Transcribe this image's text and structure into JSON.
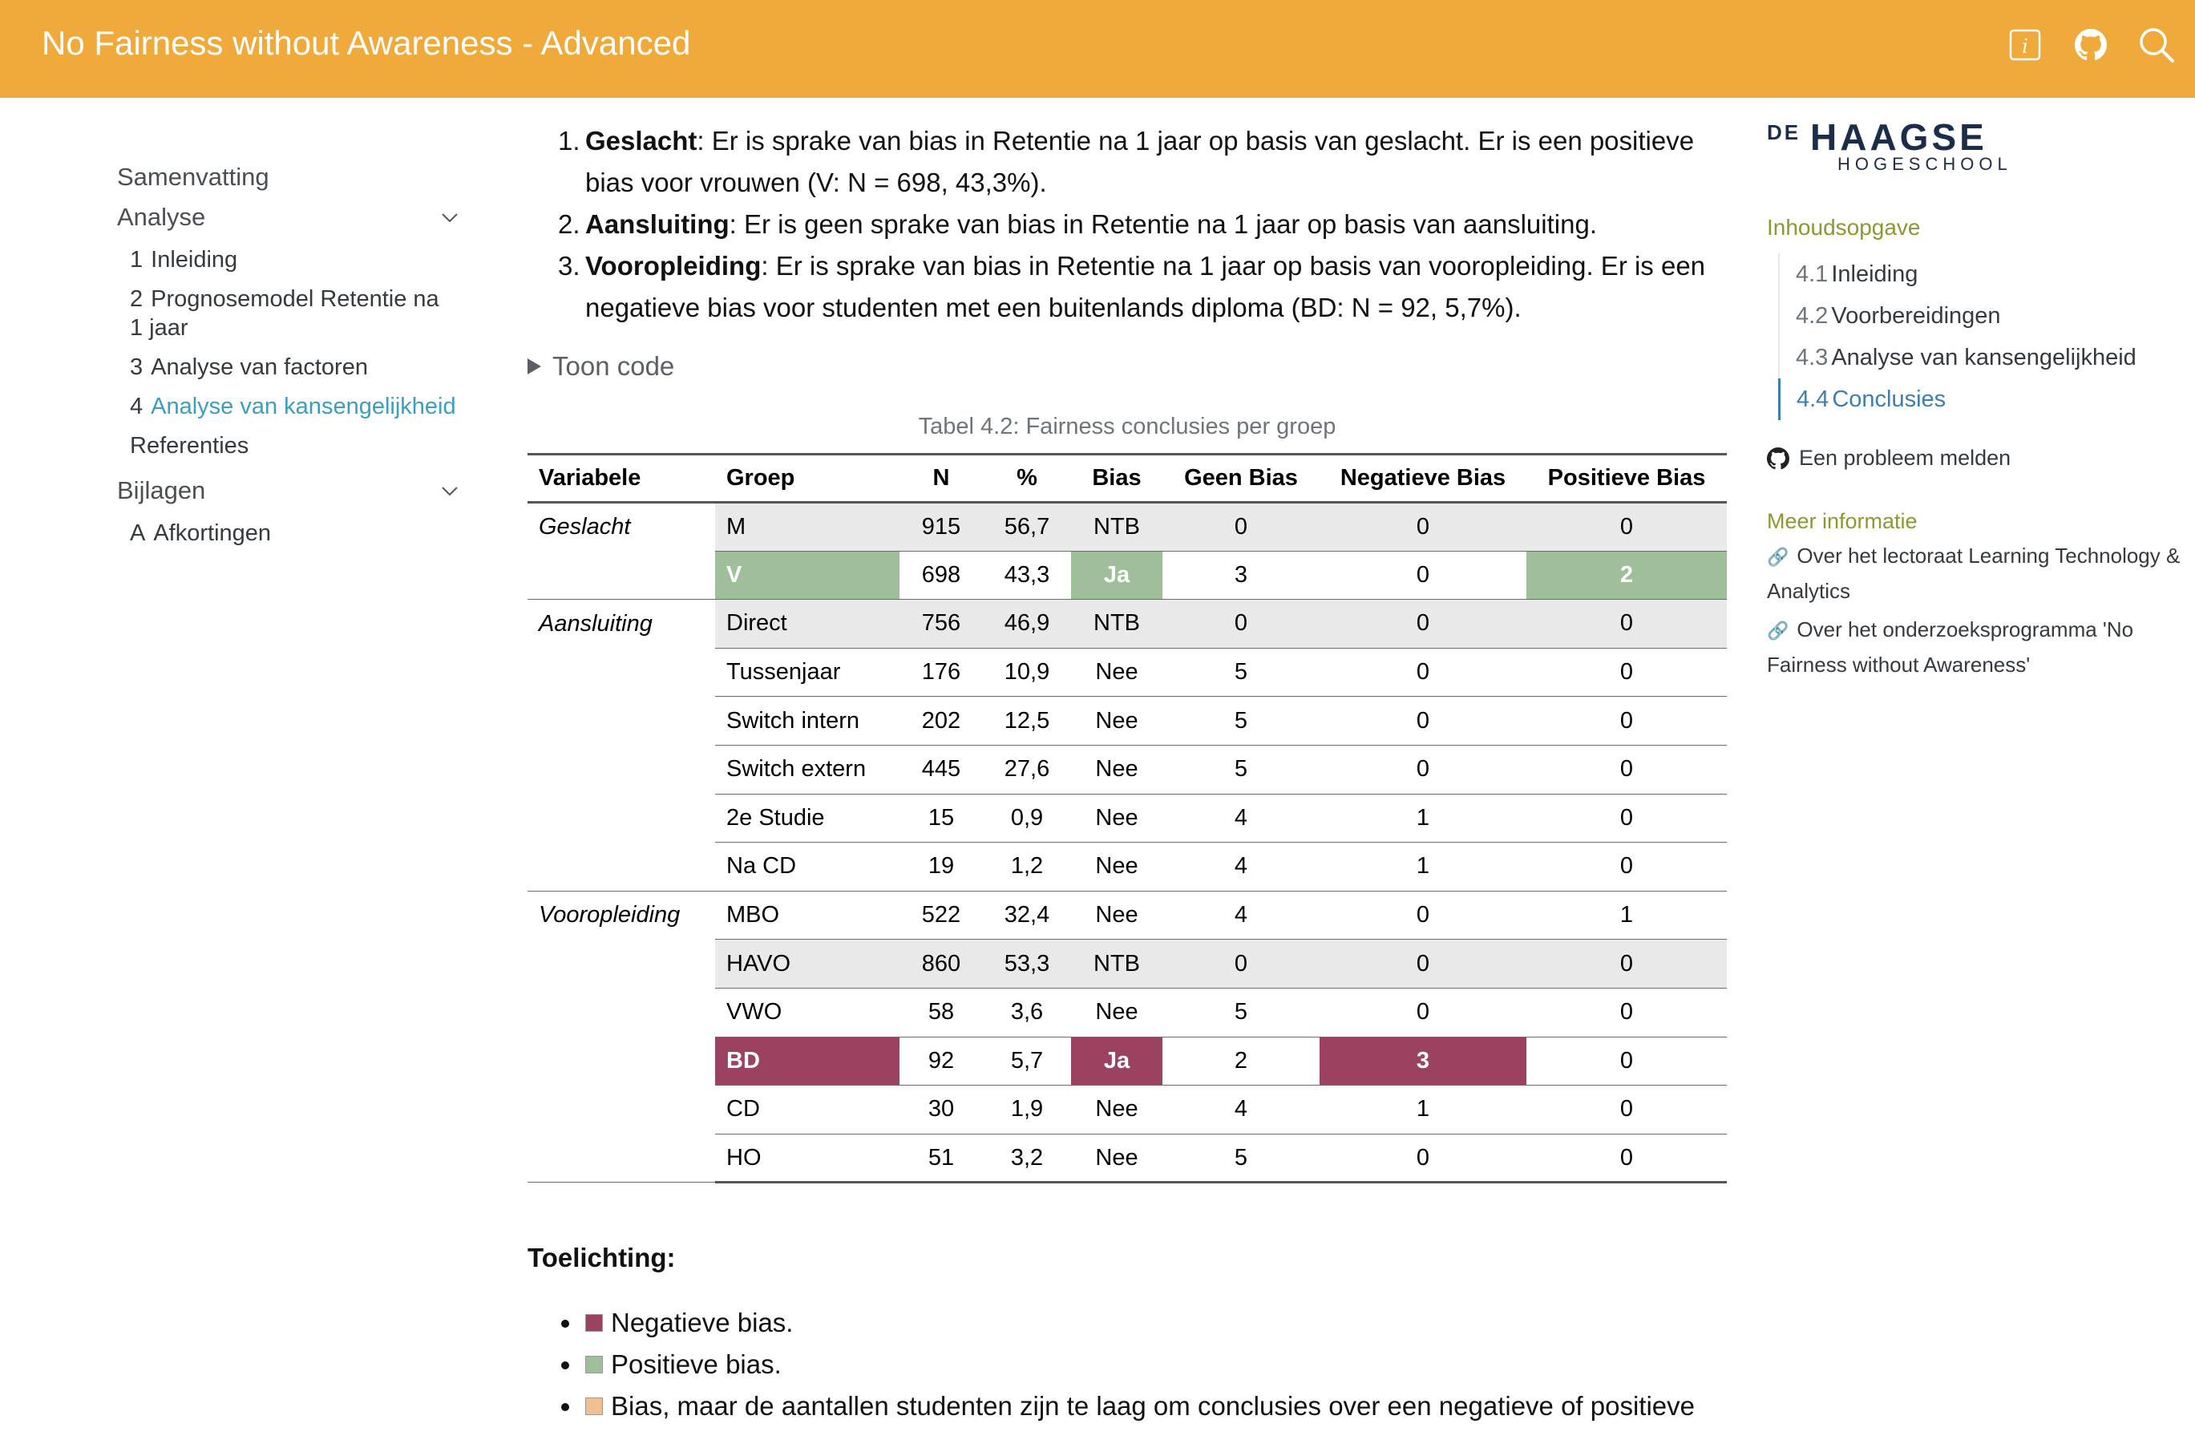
{
  "header": {
    "title": "No Fairness without Awareness - Advanced",
    "icons": [
      "info-icon",
      "github-icon",
      "search-icon"
    ]
  },
  "sidebar": {
    "items": [
      {
        "label": "Samenvatting"
      },
      {
        "label": "Analyse",
        "expandable": true
      },
      {
        "num": "1",
        "label": "Inleiding"
      },
      {
        "num": "2",
        "label": "Prognosemodel Retentie na 1 jaar"
      },
      {
        "num": "3",
        "label": "Analyse van factoren"
      },
      {
        "num": "4",
        "label": "Analyse van kansengelijkheid",
        "active": true
      },
      {
        "label": "Referenties"
      },
      {
        "label": "Bijlagen",
        "expandable": true
      },
      {
        "num": "A",
        "label": "Afkortingen"
      }
    ]
  },
  "findings": [
    {
      "num": "1.",
      "term": "Geslacht",
      "text": ": Er is sprake van bias in Retentie na 1 jaar op basis van geslacht. Er is een positieve bias voor vrouwen (V: N = 698, 43,3%)."
    },
    {
      "num": "2.",
      "term": "Aansluiting",
      "text": ": Er is geen sprake van bias in Retentie na 1 jaar op basis van aansluiting."
    },
    {
      "num": "3.",
      "term": "Vooropleiding",
      "text": ": Er is sprake van bias in Retentie na 1 jaar op basis van vooropleiding. Er is een negatieve bias voor studenten met een buitenlands diploma (BD: N = 92, 5,7%)."
    }
  ],
  "toon_code": "Toon code",
  "table": {
    "caption": "Tabel 4.2: Fairness conclusies per groep",
    "headers": [
      "Variabele",
      "Groep",
      "N",
      "%",
      "Bias",
      "Geen Bias",
      "Negatieve Bias",
      "Positieve Bias"
    ],
    "groups": [
      {
        "variable": "Geslacht",
        "rows": [
          {
            "groep": "M",
            "n": "915",
            "pct": "56,7",
            "bias": "NTB",
            "geen": "0",
            "neg": "0",
            "pos": "0",
            "style": "gray"
          },
          {
            "groep": "V",
            "n": "698",
            "pct": "43,3",
            "bias": "Ja",
            "geen": "3",
            "neg": "0",
            "pos": "2",
            "style": "positive"
          }
        ]
      },
      {
        "variable": "Aansluiting",
        "rows": [
          {
            "groep": "Direct",
            "n": "756",
            "pct": "46,9",
            "bias": "NTB",
            "geen": "0",
            "neg": "0",
            "pos": "0",
            "style": "gray"
          },
          {
            "groep": "Tussenjaar",
            "n": "176",
            "pct": "10,9",
            "bias": "Nee",
            "geen": "5",
            "neg": "0",
            "pos": "0",
            "style": ""
          },
          {
            "groep": "Switch intern",
            "n": "202",
            "pct": "12,5",
            "bias": "Nee",
            "geen": "5",
            "neg": "0",
            "pos": "0",
            "style": ""
          },
          {
            "groep": "Switch extern",
            "n": "445",
            "pct": "27,6",
            "bias": "Nee",
            "geen": "5",
            "neg": "0",
            "pos": "0",
            "style": ""
          },
          {
            "groep": "2e Studie",
            "n": "15",
            "pct": "0,9",
            "bias": "Nee",
            "geen": "4",
            "neg": "1",
            "pos": "0",
            "style": ""
          },
          {
            "groep": "Na CD",
            "n": "19",
            "pct": "1,2",
            "bias": "Nee",
            "geen": "4",
            "neg": "1",
            "pos": "0",
            "style": ""
          }
        ]
      },
      {
        "variable": "Vooropleiding",
        "rows": [
          {
            "groep": "MBO",
            "n": "522",
            "pct": "32,4",
            "bias": "Nee",
            "geen": "4",
            "neg": "0",
            "pos": "1",
            "style": ""
          },
          {
            "groep": "HAVO",
            "n": "860",
            "pct": "53,3",
            "bias": "NTB",
            "geen": "0",
            "neg": "0",
            "pos": "0",
            "style": "gray"
          },
          {
            "groep": "VWO",
            "n": "58",
            "pct": "3,6",
            "bias": "Nee",
            "geen": "5",
            "neg": "0",
            "pos": "0",
            "style": ""
          },
          {
            "groep": "BD",
            "n": "92",
            "pct": "5,7",
            "bias": "Ja",
            "geen": "2",
            "neg": "3",
            "pos": "0",
            "style": "negative"
          },
          {
            "groep": "CD",
            "n": "30",
            "pct": "1,9",
            "bias": "Nee",
            "geen": "4",
            "neg": "1",
            "pos": "0",
            "style": ""
          },
          {
            "groep": "HO",
            "n": "51",
            "pct": "3,2",
            "bias": "Nee",
            "geen": "5",
            "neg": "0",
            "pos": "0",
            "style": ""
          }
        ]
      }
    ]
  },
  "toelichting": {
    "heading": "Toelichting:",
    "items": [
      {
        "label": "Negatieve bias.",
        "color": "#9c4261"
      },
      {
        "label": "Positieve bias.",
        "color": "#9fbf9a"
      },
      {
        "label": "Bias, maar de aantallen studenten zijn te laag om conclusies over een negatieve of positieve",
        "color": "#f1c090"
      }
    ]
  },
  "colors": {
    "header": "#f0a93b",
    "negative": "#9c4261",
    "positive": "#9fbf9a",
    "neutral_gray": "#e9e9e9",
    "link": "#3a7fae",
    "section_heading": "#8a9a2e"
  },
  "right": {
    "logo": {
      "de": "DE",
      "haagse": "HAAGSE",
      "hogeschool": "HOGESCHOOL"
    },
    "toc_title": "Inhoudsopgave",
    "toc": [
      {
        "num": "4.1",
        "label": "Inleiding"
      },
      {
        "num": "4.2",
        "label": "Voorbereidingen"
      },
      {
        "num": "4.3",
        "label": "Analyse van kansengelijkheid"
      },
      {
        "num": "4.4",
        "label": "Conclusies",
        "active": true
      }
    ],
    "issue_link": "Een probleem melden",
    "meer_title": "Meer informatie",
    "links": [
      "Over het lectoraat Learning Technology & Analytics",
      "Over het onderzoeksprogramma 'No Fairness without Awareness'"
    ]
  }
}
